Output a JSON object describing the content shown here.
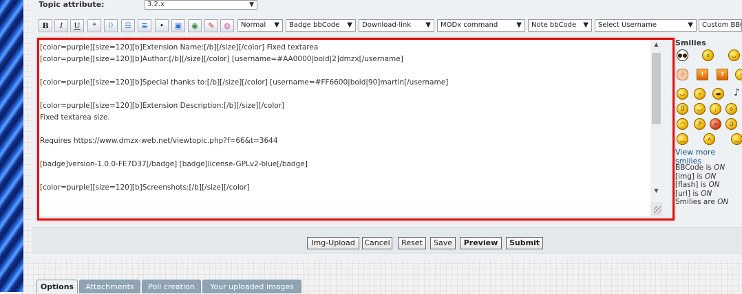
{
  "topic": {
    "label": "Topic attribute:",
    "selected": "3.2.x"
  },
  "toolbar": {
    "buttons": [
      {
        "label": "B",
        "name": "bold-button"
      },
      {
        "label": "I",
        "name": "italic-button"
      },
      {
        "label": "U",
        "name": "underline-button"
      },
      {
        "label": "❝",
        "name": "quote-icon"
      },
      {
        "label": "⟨⟩",
        "name": "code-icon"
      },
      {
        "label": "☰",
        "name": "list-icon"
      },
      {
        "label": "≣",
        "name": "numbered-list-icon"
      },
      {
        "label": "•",
        "name": "list-item-icon"
      },
      {
        "label": "▣",
        "name": "image-icon"
      },
      {
        "label": "◉",
        "name": "url-icon"
      },
      {
        "label": "✎",
        "name": "flash-icon"
      },
      {
        "label": "◍",
        "name": "color-picker-icon"
      }
    ],
    "selects": [
      {
        "label": "Normal",
        "name": "font-size-select"
      },
      {
        "label": "Badge bbCode",
        "name": "badge-bbcode-select"
      },
      {
        "label": "Download-link",
        "name": "download-link-select"
      },
      {
        "label": "MODx command",
        "name": "modx-command-select"
      },
      {
        "label": "Note bbCode",
        "name": "note-bbcode-select"
      },
      {
        "label": "Select Username",
        "name": "select-username-select"
      },
      {
        "label": "Custom BBCo",
        "name": "custom-bbcode-select"
      }
    ]
  },
  "editor": {
    "lines": [
      "[color=purple][size=120][b]Extension Name:[/b][/size][/color] Fixed textarea",
      "[color=purple][size=120][b]Author:[/b][/size][/color] [username=#AA0000|bold|2]dmzx[/username]",
      "",
      "[color=purple][size=120][b]Special thanks to:[/b][/size][/color] [username=#FF6600|bold|90]martin[/username]",
      "",
      "[color=purple][size=120][b]Extension Description:[/b][/size][/color]",
      "Fixed textarea size.",
      "",
      "Requires https://www.dmzx-web.net/viewtopic.php?f=66&t=3644",
      "",
      "[badge]version-1.0.0-FE7D37[/badge] [badge]license-GPLv2-blue[/badge]",
      "",
      "[color=purple][size=120][b]Screenshots:[/b][/size][/color]"
    ]
  },
  "smilies": {
    "title": "Smilies",
    "view_more": "View more smilies"
  },
  "status": {
    "bbcode_prefix": "BBCode is ",
    "bbcode_value": "ON",
    "img_prefix": "[img] is ",
    "img_value": "ON",
    "flash_prefix": "[flash] is ",
    "flash_value": "ON",
    "url_prefix": "[url] is ",
    "url_value": "ON",
    "smilies_prefix": "Smilies are ",
    "smilies_value": "ON"
  },
  "actions": {
    "img_upload": "Img-Upload",
    "cancel": "Cancel",
    "reset": "Reset",
    "save": "Save",
    "preview": "Preview",
    "submit": "Submit"
  },
  "tabs": [
    {
      "label": "Options"
    },
    {
      "label": "Attachments"
    },
    {
      "label": "Poll creation"
    },
    {
      "label": "Your uploaded images"
    }
  ]
}
